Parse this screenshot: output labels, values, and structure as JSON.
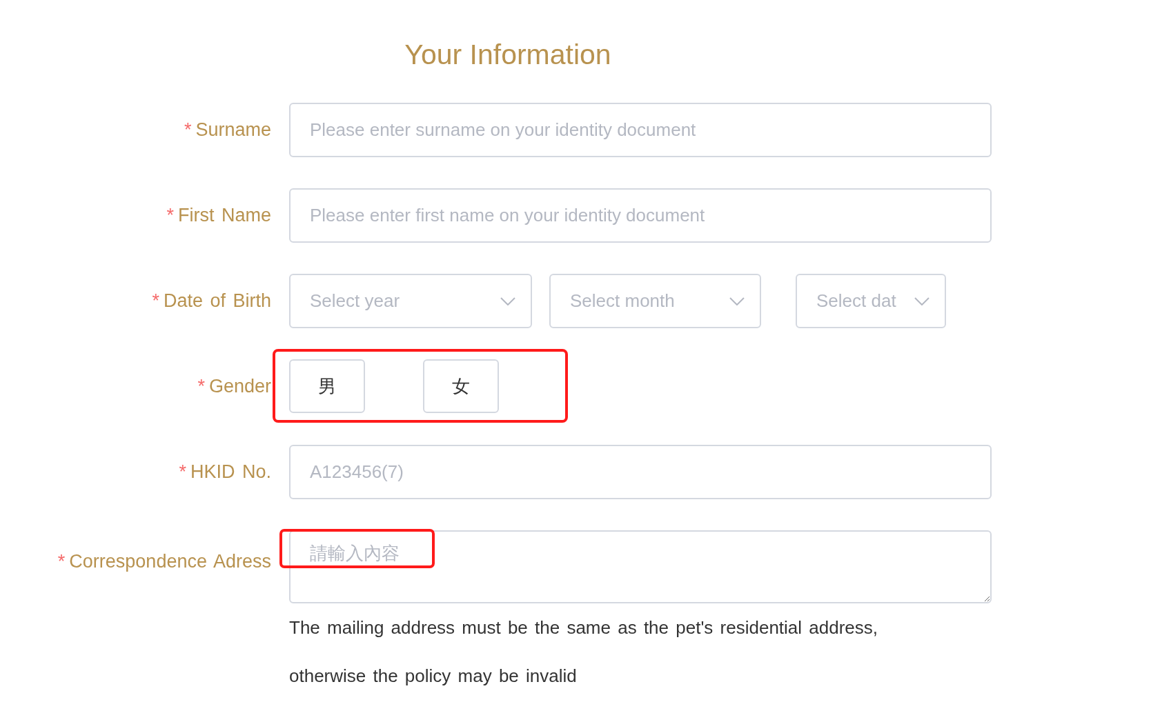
{
  "title": "Your Information",
  "fields": [
    {
      "kind": "text",
      "required": "*",
      "label": "Surname",
      "placeholder": "Please enter surname on your identity document"
    },
    {
      "kind": "text",
      "required": "*",
      "label": "First Name",
      "placeholder": "Please enter first name on your identity document"
    },
    {
      "kind": "date",
      "required": "*",
      "label": "Date of Birth",
      "selects": [
        {
          "placeholder": "Select year"
        },
        {
          "placeholder": "Select month"
        },
        {
          "placeholder": "Select dat"
        }
      ]
    },
    {
      "kind": "choice",
      "required": "*",
      "label": "Gender",
      "highlighted": true,
      "options": [
        {
          "label": "男",
          "selected": false
        },
        {
          "label": "女",
          "selected": false
        }
      ]
    },
    {
      "kind": "text",
      "required": "*",
      "label": "HKID No.",
      "placeholder": "A123456(7)"
    },
    {
      "kind": "textarea",
      "required": "*",
      "label": "Correspondence Adress",
      "placeholder": "請輸入內容",
      "highlighted": true,
      "note": "The mailing address must be the same as the pet's residential address, otherwise the policy may be invalid"
    }
  ]
}
